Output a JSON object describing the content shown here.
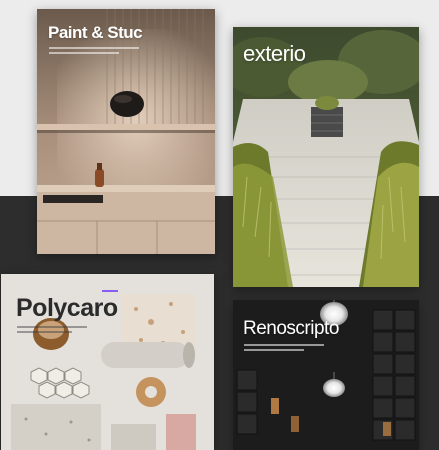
{
  "covers": [
    {
      "title": "Paint & Stuc"
    },
    {
      "title": "exterio"
    },
    {
      "title": "Polycaro"
    },
    {
      "title": "Renoscripto"
    }
  ],
  "colors": {
    "page_top": "#ececec",
    "page_bottom": "#2d2d2d",
    "accent_purple": "#8a5cf6"
  }
}
